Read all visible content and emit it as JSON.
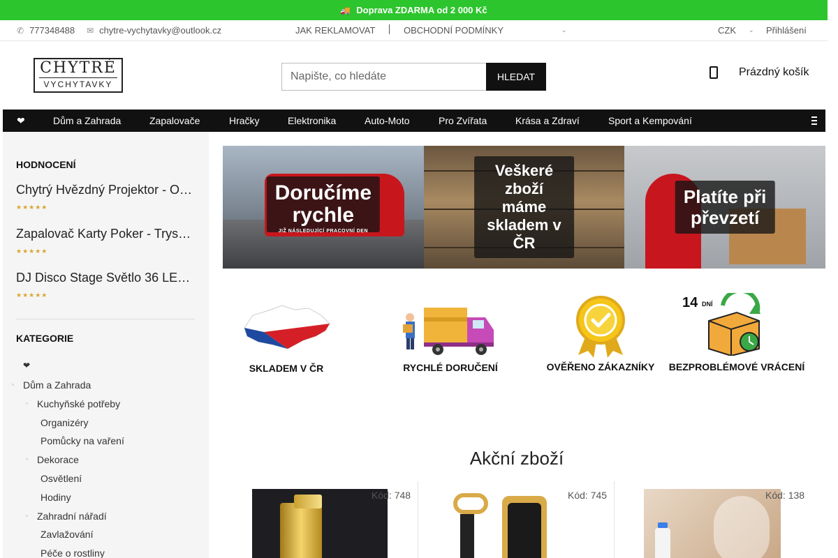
{
  "promo": {
    "icon": "truck-icon",
    "text": "Doprava ZDARMA od 2 000 Kč"
  },
  "topbar": {
    "phone": "777348488",
    "email": "chytre-vychytavky@outlook.cz",
    "links": [
      "JAK REKLAMOVAT",
      "OBCHODNÍ PODMÍNKY"
    ],
    "currency": "CZK",
    "login": "Přihlášení"
  },
  "header": {
    "logo_line1": "CHYTRÉ",
    "logo_line2": "VYCHYTAVKY",
    "search_placeholder": "Napište, co hledáte",
    "search_button": "HLEDAT",
    "cart_label": "Prázdný košík"
  },
  "nav": {
    "fav": "❤",
    "items": [
      "Dům a Zahrada",
      "Zapalovače",
      "Hračky",
      "Elektronika",
      "Auto-Moto",
      "Pro Zvířata",
      "Krása a Zdraví",
      "Sport a Kempování"
    ]
  },
  "sidebar": {
    "ratings_title": "HODNOCENÍ",
    "rated_products": [
      {
        "name": "Chytrý Hvězdný Projektor - O…",
        "rating": 5
      },
      {
        "name": "Zapalovač Karty Poker - Trys…",
        "rating": 5
      },
      {
        "name": "DJ Disco Stage Světlo 36 LE…",
        "rating": 5
      }
    ],
    "categories_title": "KATEGORIE",
    "fav": "❤",
    "categories": [
      {
        "label": "Dům a Zahrada",
        "level": 0
      },
      {
        "label": "Kuchyňské potřeby",
        "level": 1
      },
      {
        "label": "Organizéry",
        "level": 2
      },
      {
        "label": "Pomůcky na vaření",
        "level": 2
      },
      {
        "label": "Dekorace",
        "level": 1
      },
      {
        "label": "Osvětlení",
        "level": 2
      },
      {
        "label": "Hodiny",
        "level": 2
      },
      {
        "label": "Zahradní nářadí",
        "level": 1
      },
      {
        "label": "Zavlažování",
        "level": 2
      },
      {
        "label": "Péče o rostliny",
        "level": 2
      }
    ]
  },
  "banners": [
    {
      "caption": "Doručíme\nrychle",
      "sub": "JIŽ NÁSLEDUJÍCÍ PRACOVNÍ DEN"
    },
    {
      "caption": "Veškeré\nzboží máme\nskladem v ČR"
    },
    {
      "caption": "Platíte při\npřevzetí"
    }
  ],
  "badges": [
    {
      "label": "SKLADEM V ČR",
      "icon": "czech-map-icon"
    },
    {
      "label": "RYCHLÉ DORUČENÍ",
      "icon": "delivery-truck-icon"
    },
    {
      "label": "OVĚŘENO ZÁKAZNÍKY",
      "icon": "verified-medal-icon"
    },
    {
      "label": "BEZPROBLÉMOVÉ VRÁCENÍ",
      "icon": "return-box-icon",
      "days_number": "14",
      "days_word": "DNÍ"
    }
  ],
  "sale": {
    "title": "Akční zboží",
    "products": [
      {
        "code": "Kód: 748",
        "image": "gold-lighter"
      },
      {
        "code": "Kód: 745",
        "image": "gold-watch"
      },
      {
        "code": "Kód: 138",
        "image": "humidifier"
      }
    ]
  },
  "colors": {
    "promo_green": "#2dc52d",
    "nav_black": "#111111",
    "sidebar_bg": "#f5f5f5",
    "star_gold": "#d9a62e"
  }
}
